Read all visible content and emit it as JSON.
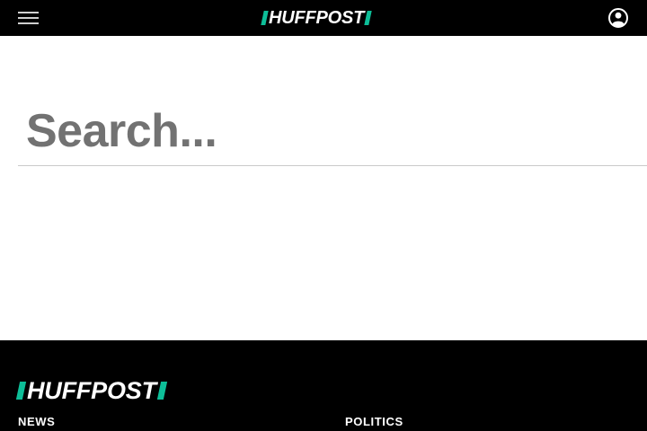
{
  "header": {
    "menu_icon": "hamburger-menu-icon",
    "logo_text": "HUFFPOST",
    "user_icon": "user-account-icon"
  },
  "search": {
    "placeholder": "Search...",
    "value": ""
  },
  "footer": {
    "logo_text": "HUFFPOST",
    "links": [
      "NEWS",
      "POLITICS"
    ]
  },
  "colors": {
    "brand_black": "#000000",
    "brand_green": "#0dbe98",
    "placeholder_gray": "#727272",
    "divider_gray": "#c9c9c9"
  }
}
